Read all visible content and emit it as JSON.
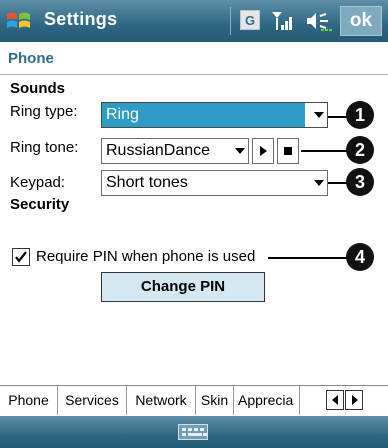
{
  "titlebar": {
    "title": "Settings",
    "ime_label": "G",
    "ok_label": "ok"
  },
  "page": {
    "heading": "Phone"
  },
  "sounds": {
    "section_label": "Sounds",
    "ring_type_label": "Ring type:",
    "ring_type_value": "Ring",
    "ring_tone_label": "Ring tone:",
    "ring_tone_value": "RussianDance",
    "keypad_label": "Keypad:",
    "keypad_value": "Short tones"
  },
  "security": {
    "section_label": "Security",
    "require_pin_label": "Require PIN when phone is used",
    "require_pin_checked": true,
    "change_pin_label": "Change PIN"
  },
  "callouts": [
    "1",
    "2",
    "3",
    "4"
  ],
  "tabs": [
    {
      "label": "Phone",
      "active": true
    },
    {
      "label": "Services",
      "active": false
    },
    {
      "label": "Network",
      "active": false
    },
    {
      "label": "Skin",
      "active": false
    },
    {
      "label": "Apprecia",
      "active": false
    }
  ],
  "colors": {
    "titlebar": "#2f6783",
    "heading": "#2e6d8c",
    "selection": "#2f9cc6",
    "button_fill": "#d5e8f1"
  }
}
